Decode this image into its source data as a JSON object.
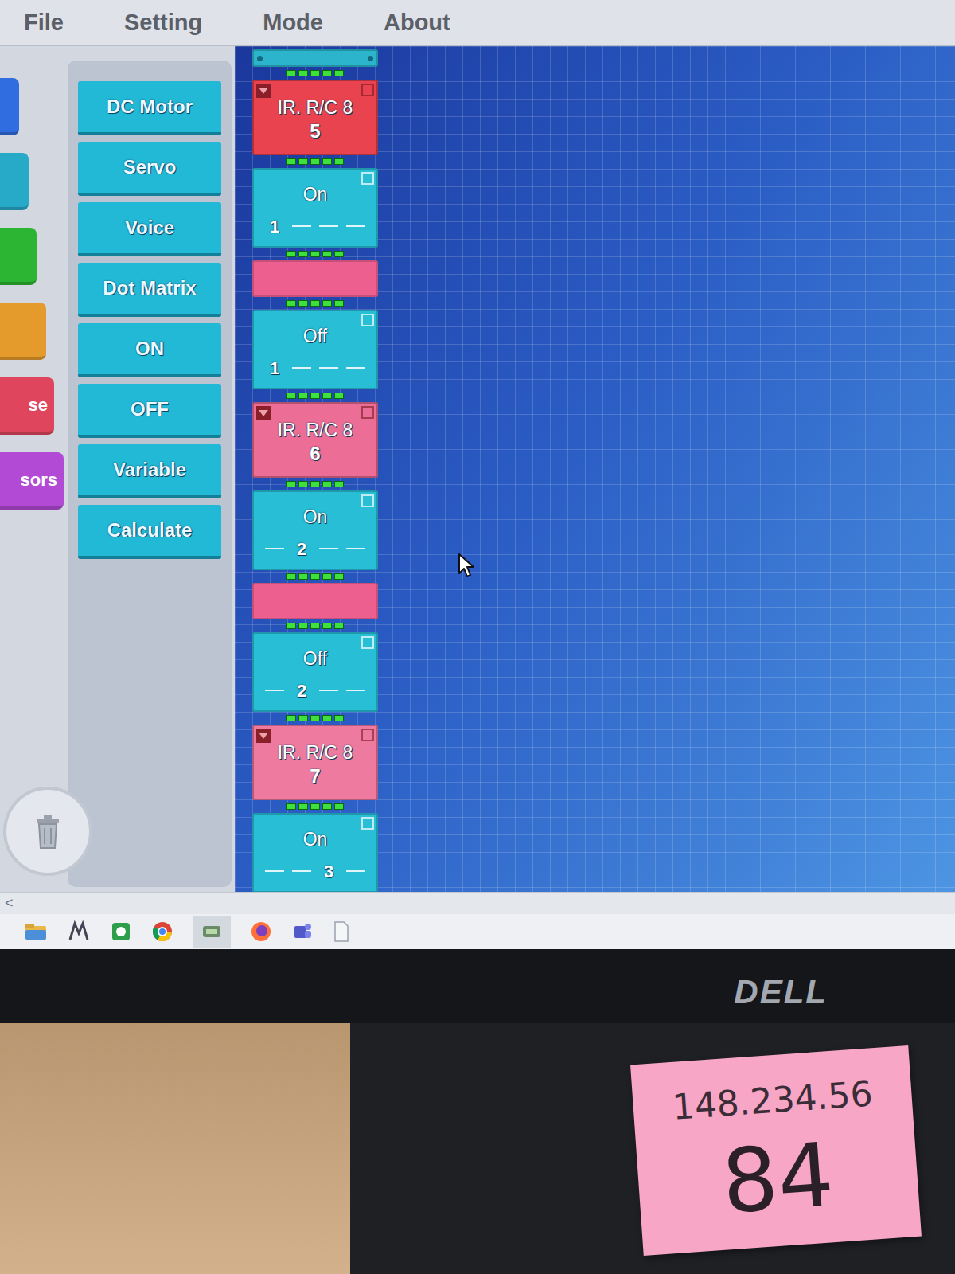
{
  "menu": [
    "File",
    "Setting",
    "Mode",
    "About"
  ],
  "categories": [
    {
      "label": "",
      "color": "#2f6de0"
    },
    {
      "label": "",
      "color": "#27a9c8"
    },
    {
      "label": "",
      "color": "#2cb533"
    },
    {
      "label": "",
      "color": "#e59a2c"
    },
    {
      "label": "se",
      "color": "#e0455e"
    },
    {
      "label": "sors",
      "color": "#b34ad6"
    }
  ],
  "palette": [
    "DC Motor",
    "Servo",
    "Voice",
    "Dot Matrix",
    "ON",
    "OFF",
    "Variable",
    "Calculate"
  ],
  "program": [
    {
      "kind": "header",
      "color": "#2bb4cc"
    },
    {
      "kind": "ir",
      "label": "IR. R/C 8",
      "value": "5",
      "color": "#e8434f"
    },
    {
      "kind": "port",
      "label": "On",
      "ports": [
        "1",
        "",
        "",
        ""
      ],
      "color": "#28bfd6"
    },
    {
      "kind": "bar",
      "color": "#ec5f8e"
    },
    {
      "kind": "port",
      "label": "Off",
      "ports": [
        "1",
        "",
        "",
        ""
      ],
      "color": "#28bfd6"
    },
    {
      "kind": "ir",
      "label": "IR. R/C 8",
      "value": "6",
      "color": "#ec6d95"
    },
    {
      "kind": "port",
      "label": "On",
      "ports": [
        "",
        "2",
        "",
        ""
      ],
      "color": "#28bfd6"
    },
    {
      "kind": "bar",
      "color": "#ec5f8e"
    },
    {
      "kind": "port",
      "label": "Off",
      "ports": [
        "",
        "2",
        "",
        ""
      ],
      "color": "#28bfd6"
    },
    {
      "kind": "ir",
      "label": "IR. R/C 8",
      "value": "7",
      "color": "#ef7aa0"
    },
    {
      "kind": "port",
      "label": "On",
      "ports": [
        "",
        "",
        "3",
        ""
      ],
      "color": "#28bfd6"
    },
    {
      "kind": "bar",
      "color": "#ec5f8e"
    }
  ],
  "scrollbar": {
    "arrow": "<"
  },
  "monitor": {
    "brand": "DELL"
  },
  "sticky_note": {
    "lines": [
      "148.234.56",
      "84"
    ]
  }
}
